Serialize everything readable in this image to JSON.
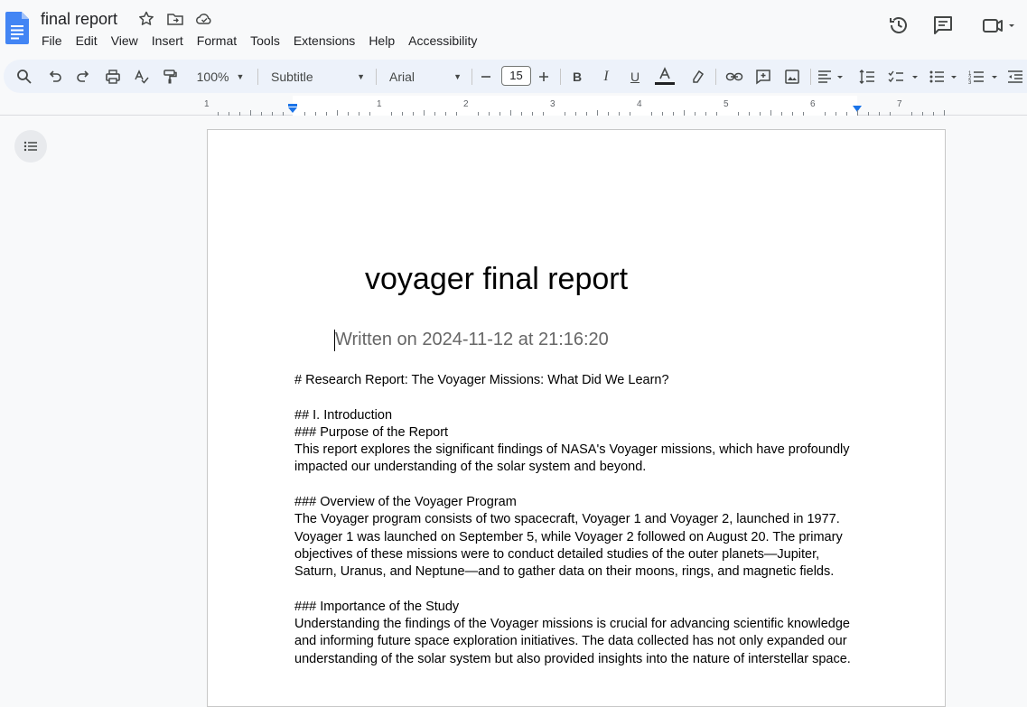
{
  "app": {
    "title": "final report",
    "menu": [
      "File",
      "Edit",
      "View",
      "Insert",
      "Format",
      "Tools",
      "Extensions",
      "Help",
      "Accessibility"
    ]
  },
  "toolbar": {
    "zoom": "100%",
    "style": "Subtitle",
    "font": "Arial",
    "font_size": "15"
  },
  "ruler": {
    "numbers": [
      "1",
      "1",
      "2",
      "3",
      "4",
      "5",
      "6",
      "7"
    ]
  },
  "document": {
    "title": "voyager final report",
    "subtitle": "Written on 2024-11-12 at 21:16:20",
    "lines": [
      "# Research Report: The Voyager Missions: What Did We Learn?",
      "",
      "## I. Introduction",
      "### Purpose of the Report",
      "This report explores the significant findings of NASA's Voyager missions, which have profoundly",
      "impacted our understanding of the solar system and beyond.",
      "",
      "### Overview of the Voyager Program",
      "The Voyager program consists of two spacecraft, Voyager 1 and Voyager 2, launched in 1977.",
      "Voyager 1 was launched on September 5, while Voyager 2 followed on August 20. The primary",
      "objectives of these missions were to conduct detailed studies of the outer planets—Jupiter,",
      "Saturn, Uranus, and Neptune—and to gather data on their moons, rings, and magnetic fields.",
      "",
      "### Importance of the Study",
      "Understanding the findings of the Voyager missions is crucial for advancing scientific knowledge",
      "and informing future space exploration initiatives. The data collected has not only expanded our",
      "understanding of the solar system but also provided insights into the nature of interstellar space."
    ]
  }
}
